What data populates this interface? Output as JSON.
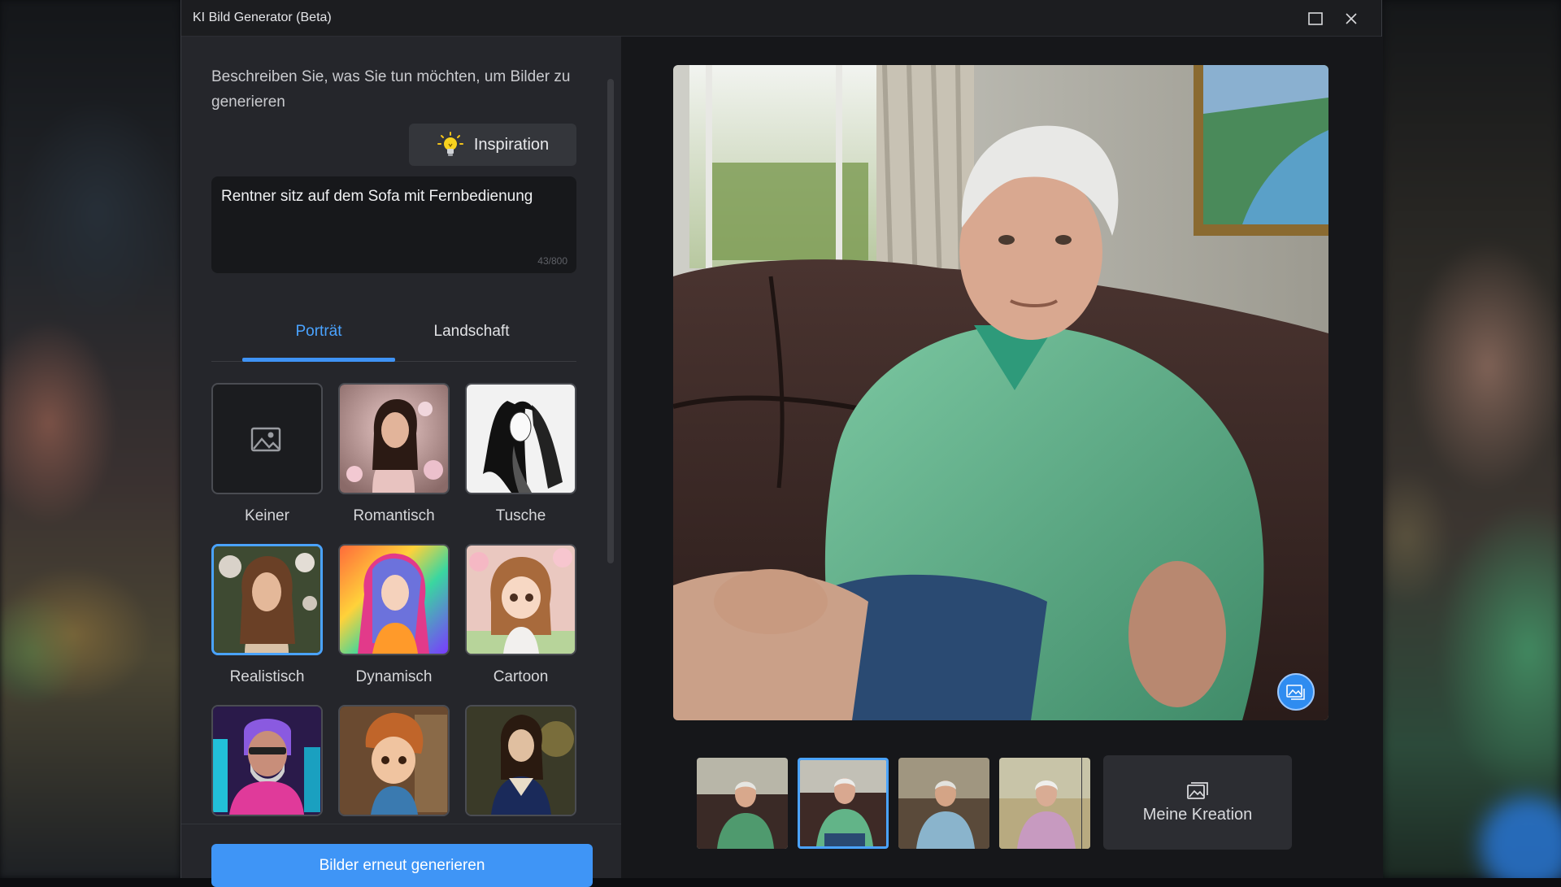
{
  "window": {
    "title": "KI Bild Generator (Beta)"
  },
  "prompt": {
    "instruction": "Beschreiben Sie, was Sie tun möchten, um Bilder zu generieren",
    "inspiration_label": "Inspiration",
    "text": "Rentner sitz auf dem Sofa mit Fernbedienung",
    "counter": "43/800"
  },
  "tabs": [
    {
      "label": "Porträt",
      "active": true
    },
    {
      "label": "Landschaft",
      "active": false
    }
  ],
  "styles": [
    {
      "label": "Keiner",
      "icon": "image-placeholder-icon"
    },
    {
      "label": "Romantisch"
    },
    {
      "label": "Tusche"
    },
    {
      "label": "Realistisch",
      "selected": true
    },
    {
      "label": "Dynamisch"
    },
    {
      "label": "Cartoon"
    }
  ],
  "actions": {
    "regenerate_label": "Bilder erneut generieren",
    "my_creation_label": "Meine Kreation"
  },
  "results": {
    "selected_index": 1,
    "count": 4
  },
  "colors": {
    "accent": "#3f95f6",
    "panel": "#25262b",
    "preview_bg": "#16171a"
  }
}
